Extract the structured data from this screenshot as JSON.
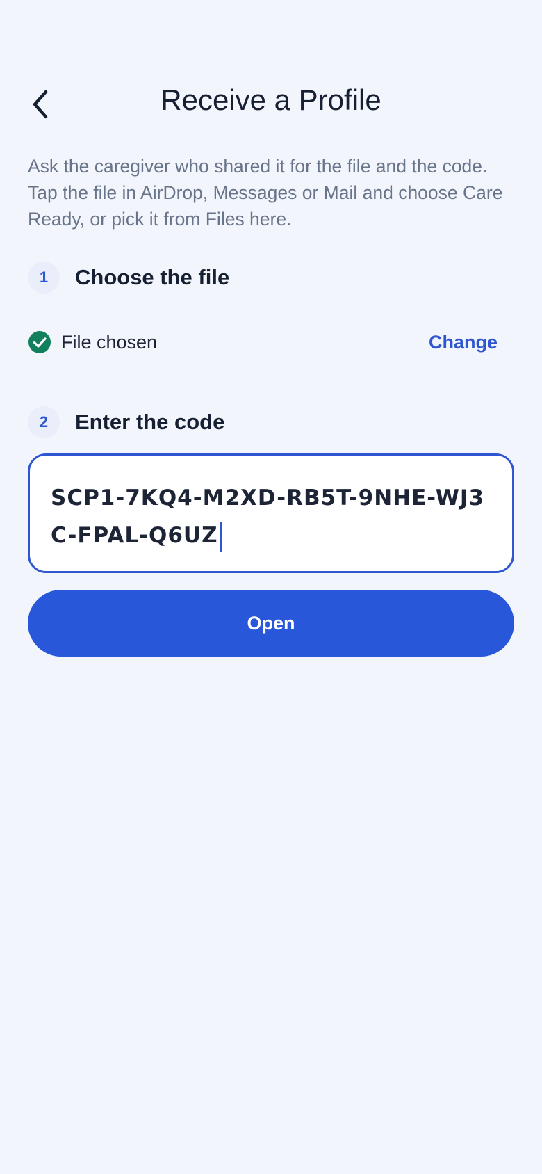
{
  "header": {
    "title": "Receive a Profile",
    "back_icon": "chevron-left-icon"
  },
  "intro": {
    "text": "Ask the caregiver who shared it for the file and the code. Tap the file in AirDrop, Messages or Mail and choose Care Ready, or pick it from Files here."
  },
  "steps": [
    {
      "number": "1",
      "title": "Choose the file"
    },
    {
      "number": "2",
      "title": "Enter the code"
    }
  ],
  "file": {
    "status": "File chosen",
    "status_icon": "check-circle-icon",
    "change_label": "Change"
  },
  "code": {
    "value": "SCP1-7KQ4-M2XD-RB5T-9NHE-WJ3C-FPAL-Q6UZ"
  },
  "actions": {
    "open_label": "Open"
  },
  "colors": {
    "background": "#f2f5fb",
    "accent": "#2857d9",
    "success": "#12805c",
    "text_primary": "#172033",
    "text_secondary": "#687489"
  }
}
